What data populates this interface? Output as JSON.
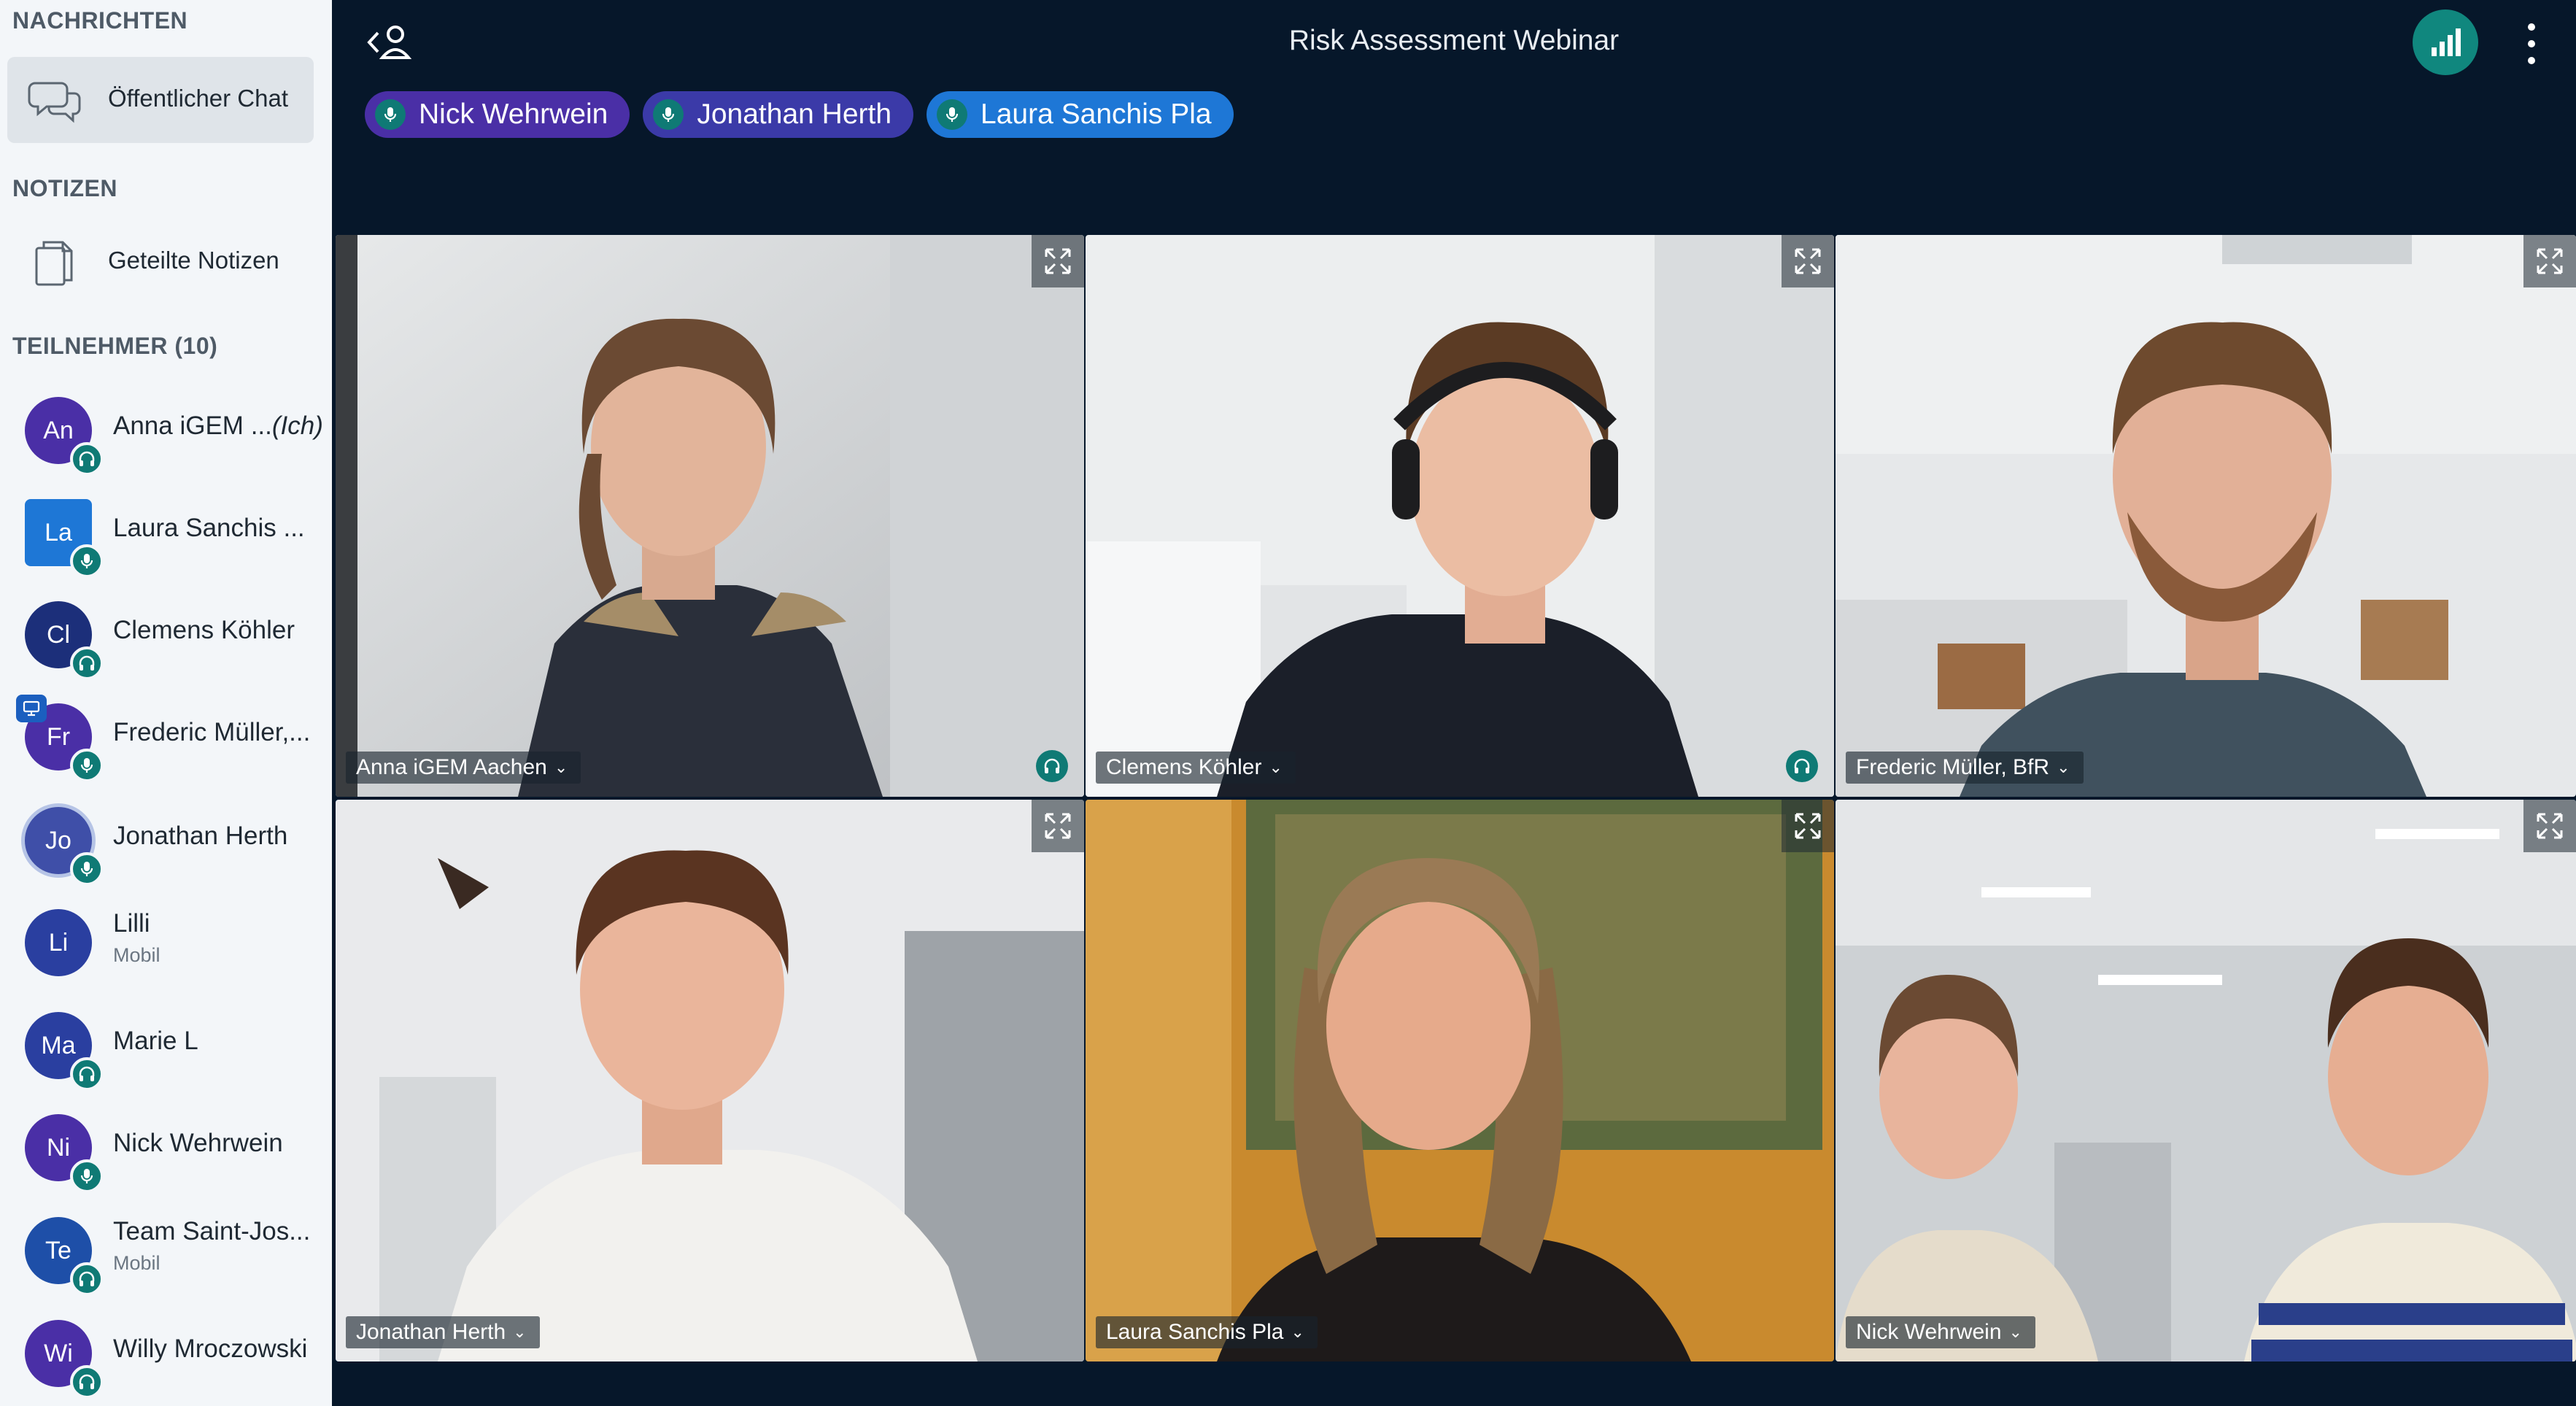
{
  "sidebar": {
    "messages_title": "NACHRICHTEN",
    "public_chat_label": "Öffentlicher Chat",
    "notes_title": "NOTIZEN",
    "shared_notes_label": "Geteilte Notizen",
    "participants_title": "TEILNEHMER (10)",
    "me_suffix": "(Ich)",
    "users": [
      {
        "initials": "An",
        "name": "Anna iGEM ...",
        "status": "headset",
        "color": "#4a2fa6"
      },
      {
        "initials": "La",
        "name": "Laura Sanchis ...",
        "status": "mic",
        "color": "#1e77d6"
      },
      {
        "initials": "Cl",
        "name": "Clemens Köhler",
        "status": "headset",
        "color": "#1c2f7a"
      },
      {
        "initials": "Fr",
        "name": "Frederic Müller,...",
        "status": "mic",
        "color": "#4a2fa6"
      },
      {
        "initials": "Jo",
        "name": "Jonathan Herth",
        "status": "mic",
        "color": "#3f4fa8"
      },
      {
        "initials": "Li",
        "name": "Lilli",
        "sub": "Mobil",
        "status": "none",
        "color": "#2a3fa0"
      },
      {
        "initials": "Ma",
        "name": "Marie L",
        "status": "headset",
        "color": "#2a3fa0"
      },
      {
        "initials": "Ni",
        "name": "Nick Wehrwein",
        "status": "mic",
        "color": "#4a2fa6"
      },
      {
        "initials": "Te",
        "name": "Team Saint-Jos...",
        "sub": "Mobil",
        "status": "headset",
        "color": "#1e4fa8"
      },
      {
        "initials": "Wi",
        "name": "Willy Mroczowski",
        "status": "headset",
        "color": "#4a2fa6"
      }
    ]
  },
  "header": {
    "title": "Risk Assessment Webinar"
  },
  "talkers": [
    {
      "name": "Nick Wehrwein",
      "color": "#4a2fa6"
    },
    {
      "name": "Jonathan Herth",
      "color": "#3b3aa8"
    },
    {
      "name": "Laura Sanchis Pla",
      "color": "#1e77d6"
    }
  ],
  "videos": [
    {
      "name": "Anna iGEM Aachen"
    },
    {
      "name": "Clemens Köhler"
    },
    {
      "name": "Frederic Müller, BfR"
    },
    {
      "name": "Jonathan Herth"
    },
    {
      "name": "Laura Sanchis Pla"
    },
    {
      "name": "Nick Wehrwein"
    }
  ]
}
